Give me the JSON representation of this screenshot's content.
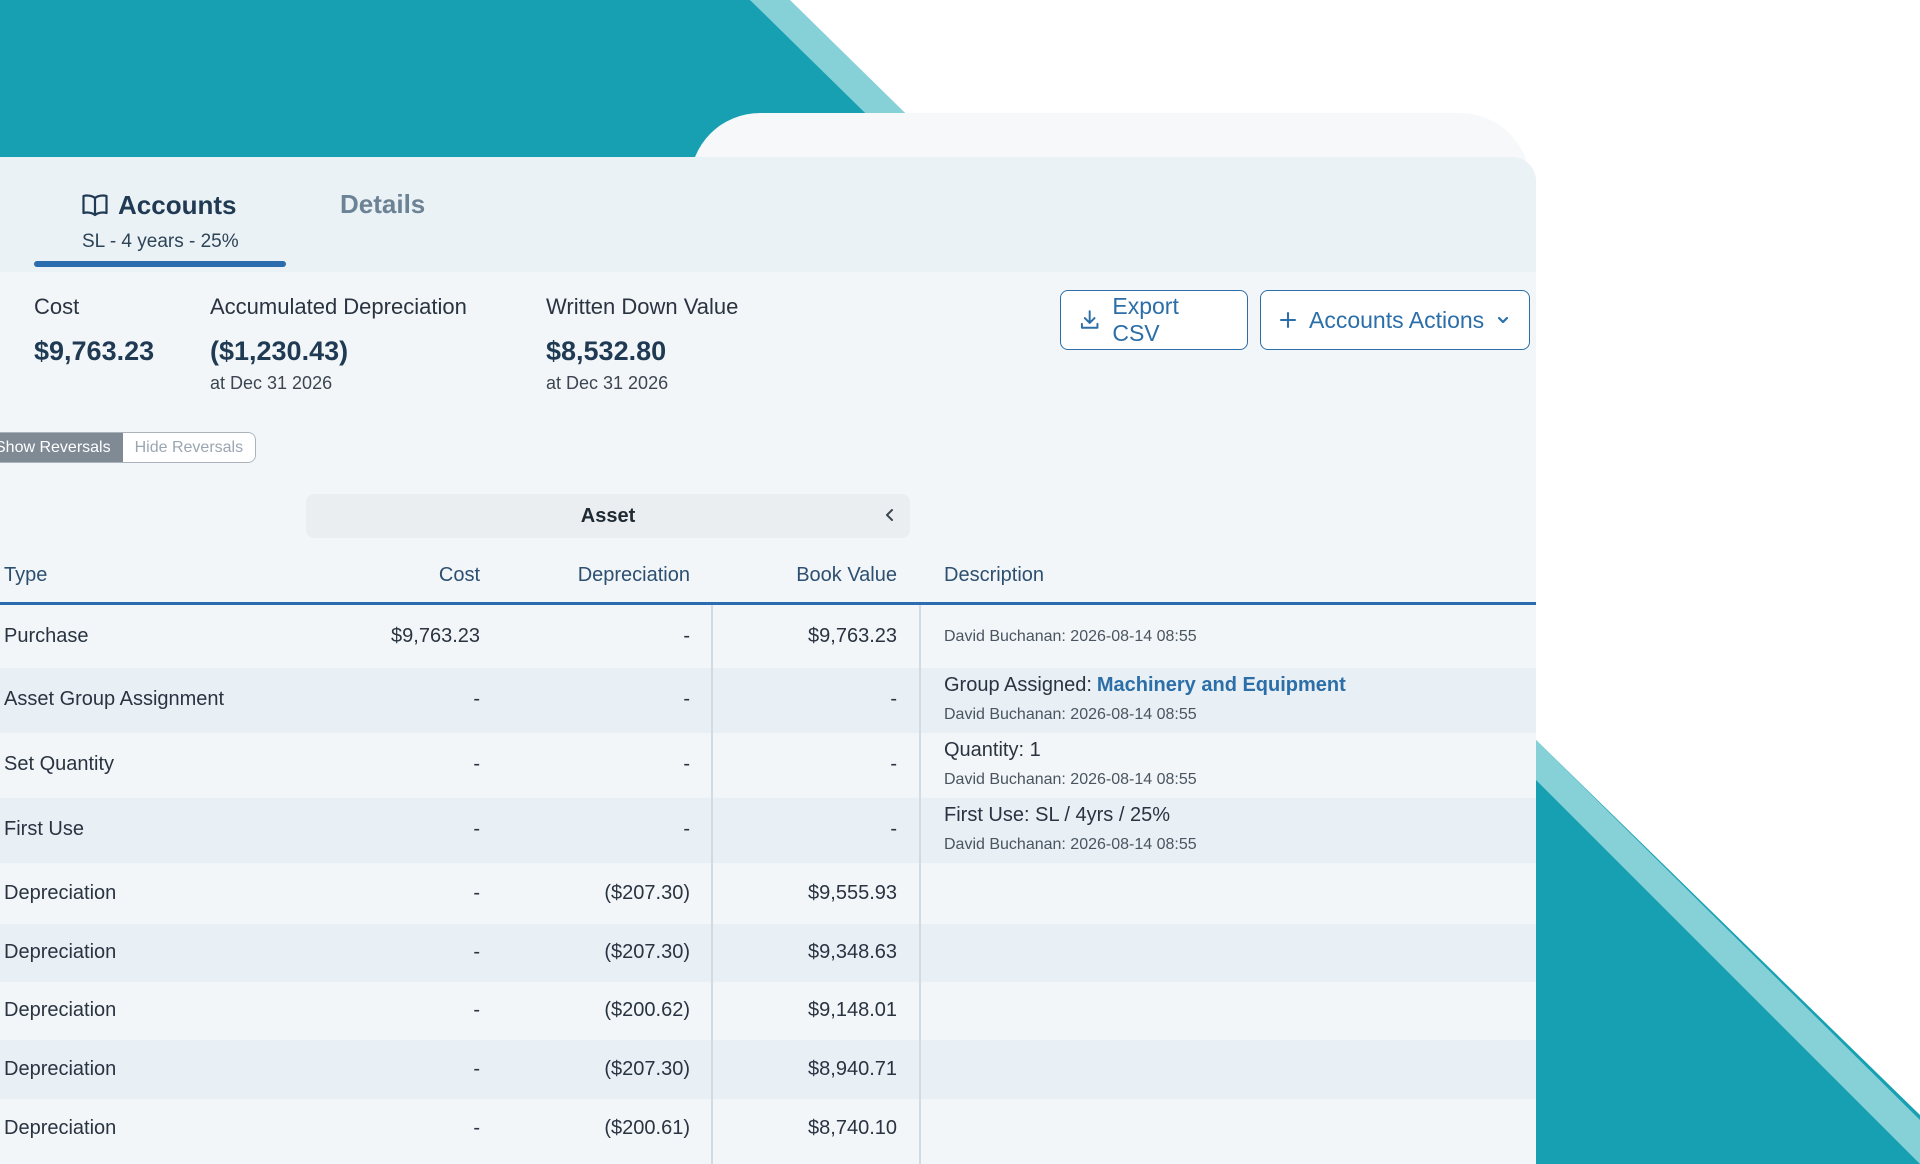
{
  "tabs": {
    "accounts": {
      "label": "Accounts",
      "subtitle": "SL - 4 years - 25%"
    },
    "details": {
      "label": "Details"
    }
  },
  "summary": {
    "cost": {
      "label": "Cost",
      "value": "$9,763.23"
    },
    "accumulated_depreciation": {
      "label": "Accumulated Depreciation",
      "value": "($1,230.43)",
      "sub": "at Dec 31 2026"
    },
    "written_down_value": {
      "label": "Written Down Value",
      "value": "$8,532.80",
      "sub": "at Dec 31 2026"
    }
  },
  "actions": {
    "export_csv": "Export CSV",
    "accounts_actions": "Accounts Actions"
  },
  "reversals_toggle": {
    "show": "Show Reversals",
    "hide": "Hide Reversals",
    "selected": "show"
  },
  "table": {
    "group_header": "Asset",
    "columns": {
      "type": "Type",
      "cost": "Cost",
      "depreciation": "Depreciation",
      "book_value": "Book Value",
      "description": "Description"
    },
    "rows": [
      {
        "type": "Purchase",
        "cost": "$9,763.23",
        "depreciation": "-",
        "book_value": "$9,763.23",
        "desc_label": "",
        "desc_value": "",
        "meta": "David Buchanan: 2026-08-14 08:55"
      },
      {
        "type": "Asset Group Assignment",
        "cost": "-",
        "depreciation": "-",
        "book_value": "-",
        "desc_label": "Group Assigned:",
        "desc_value": "Machinery and Equipment",
        "meta": "David Buchanan: 2026-08-14 08:55"
      },
      {
        "type": "Set Quantity",
        "cost": "-",
        "depreciation": "-",
        "book_value": "-",
        "desc_label": "Quantity: 1",
        "desc_value": "",
        "meta": "David Buchanan: 2026-08-14 08:55"
      },
      {
        "type": "First Use",
        "cost": "-",
        "depreciation": "-",
        "book_value": "-",
        "desc_label": "First Use: SL / 4yrs / 25%",
        "desc_value": "",
        "meta": "David Buchanan: 2026-08-14 08:55"
      },
      {
        "type": "Depreciation",
        "cost": "-",
        "depreciation": "($207.30)",
        "book_value": "$9,555.93",
        "desc_label": "",
        "desc_value": "",
        "meta": ""
      },
      {
        "type": "Depreciation",
        "cost": "-",
        "depreciation": "($207.30)",
        "book_value": "$9,348.63",
        "desc_label": "",
        "desc_value": "",
        "meta": ""
      },
      {
        "type": "Depreciation",
        "cost": "-",
        "depreciation": "($200.62)",
        "book_value": "$9,148.01",
        "desc_label": "",
        "desc_value": "",
        "meta": ""
      },
      {
        "type": "Depreciation",
        "cost": "-",
        "depreciation": "($207.30)",
        "book_value": "$8,940.71",
        "desc_label": "",
        "desc_value": "",
        "meta": ""
      },
      {
        "type": "Depreciation",
        "cost": "-",
        "depreciation": "($200.61)",
        "book_value": "$8,740.10",
        "desc_label": "",
        "desc_value": "",
        "meta": ""
      }
    ]
  },
  "colors": {
    "teal": "#16a0b1",
    "teal_light": "#86d0d8",
    "accent_blue": "#2a6cae",
    "link_blue": "#2b6ea8"
  }
}
